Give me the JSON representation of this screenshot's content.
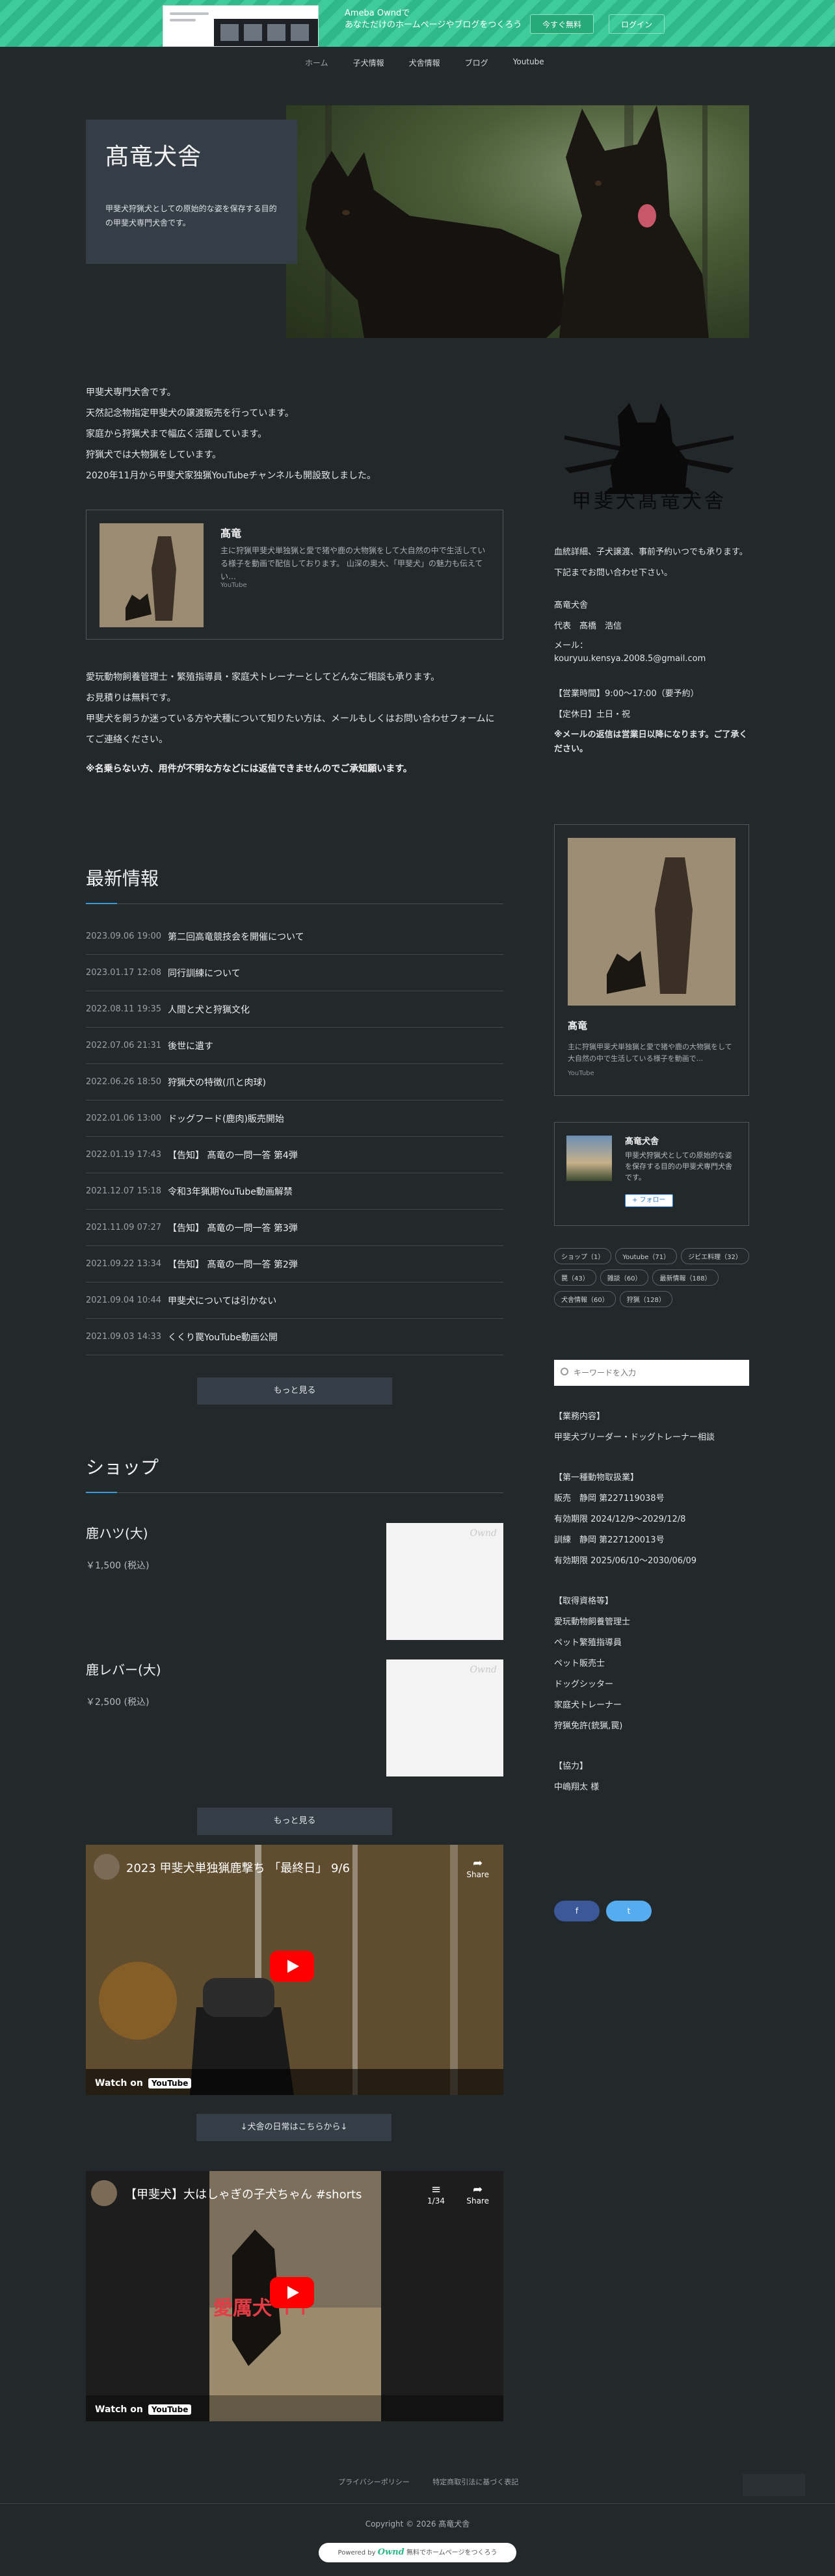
{
  "banner": {
    "copy_line1": "Ameba Owndで",
    "copy_line2": "あなただけのホームページやブログをつくろう",
    "primary_btn": "今すぐ無料",
    "secondary_btn": "ログイン"
  },
  "nav": {
    "items": [
      "ホーム",
      "子犬情報",
      "犬舎情報",
      "ブログ",
      "Youtube"
    ],
    "active": 0
  },
  "hero": {
    "title": "髙竜犬舎",
    "lead": "甲斐犬狩猟犬としての原始的な姿を保存する目的の甲斐犬専門犬舎です。"
  },
  "intro": [
    "甲斐犬専門犬舎です。",
    "天然記念物指定甲斐犬の譲渡販売を行っています。",
    "家庭から狩猟犬まで幅広く活躍しています。",
    "狩猟犬では大物猟をしています。",
    "2020年11月から甲斐犬家独猟YouTubeチャンネルも開設致しました。"
  ],
  "embed": {
    "title": "髙竜",
    "desc": "主に狩猟甲斐犬単独猟と愛で猪や鹿の大物猟をして大自然の中で生活している様子を動画で配信しております。 山深の奥大、「甲斐犬」の魅力も伝えてい…",
    "source": "YouTube"
  },
  "contact_note": [
    "愛玩動物飼養管理士・繁殖指導員・家庭犬トレーナーとしてどんなご相談も承ります。",
    "お見積りは無料です。",
    "甲斐犬を飼うか迷っている方や犬種について知りたい方は、メールもしくはお問い合わせフォームにてご連絡ください。"
  ],
  "caution": "※名乗らない方、用件が不明な方などには返信できませんのでご承知願います。",
  "news": {
    "title": "最新情報",
    "items": [
      {
        "date": "2023.09.06 19:00",
        "text": "第二回高竜競技会を開催について"
      },
      {
        "date": "2023.01.17 12:08",
        "text": "同行訓練について"
      },
      {
        "date": "2022.08.11 19:35",
        "text": "人間と犬と狩猟文化"
      },
      {
        "date": "2022.07.06 21:31",
        "text": "後世に遺す"
      },
      {
        "date": "2022.06.26 18:50",
        "text": "狩猟犬の特徴(爪と肉球)"
      },
      {
        "date": "2022.01.06 13:00",
        "text": "ドッグフード(鹿肉)販売開始"
      },
      {
        "date": "2022.01.19 17:43",
        "text": "【告知】 髙竜の一問一答 第4弾"
      },
      {
        "date": "2021.12.07 15:18",
        "text": "令和3年猟期YouTube動画解禁"
      },
      {
        "date": "2021.11.09 07:27",
        "text": "【告知】 髙竜の一問一答 第3弾"
      },
      {
        "date": "2021.09.22 13:34",
        "text": "【告知】 髙竜の一問一答 第2弾"
      },
      {
        "date": "2021.09.04 10:44",
        "text": "甲斐犬については引かない"
      },
      {
        "date": "2021.09.03 14:33",
        "text": "くくり罠YouTube動画公開"
      }
    ],
    "more": "もっと見る"
  },
  "shop": {
    "title": "ショップ",
    "items": [
      {
        "name": "鹿ハツ(大)",
        "price": "￥1,500 (税込)",
        "badge": "Ownd"
      },
      {
        "name": "鹿レバー(大)",
        "price": "￥2,500 (税込)",
        "badge": "Ownd"
      }
    ],
    "more": "もっと見る"
  },
  "videos": [
    {
      "title": "2023 甲斐犬単独猟鹿撃ち 「最終日」 9/6",
      "share": "Share",
      "watch": "Watch on",
      "yt": "YouTube"
    },
    {
      "title": "【甲斐犬】大はしゃぎの子犬ちゃん #shorts",
      "share": "Share",
      "counter": "1/34",
      "overlay": "愛厲犬 ↑↑",
      "watch": "Watch on",
      "yt": "YouTube"
    }
  ],
  "video_link": "↓犬舎の日常はこちらから↓",
  "side": {
    "logo_text": "甲斐犬髙竜犬舎",
    "visit": "血統詳細、子犬譲渡、事前予約いつでも承ります。",
    "contact": "下記までお問い合わせ下さい。",
    "shop_name": "髙竜犬舎",
    "rep": "代表　髙橋　浩信",
    "mail_label": "メール：",
    "mail": "kouryuu.kensya.2008.5@gmail.com",
    "hours": "【営業時間】9:00〜17:00（要予約）",
    "holiday": "【定休日】土日・祝",
    "mail_note": "※メールの返信は営業日以降になります。ご了承ください。",
    "embed_title": "髙竜",
    "embed_desc": "主に狩猟甲斐犬単独猟と愛で猪や鹿の大物猟をして大自然の中で生活している様子を動画で...",
    "embed_source": "YouTube",
    "profile_name": "髙竜犬舎",
    "profile_desc": "甲斐犬狩猟犬としての原始的な姿を保存する目的の甲斐犬専門犬舎です。",
    "follow": "+ フォロー",
    "tags": [
      "ショップ（1）",
      "Youtube（71）",
      "ジビエ料理（32）",
      "罠（43）",
      "雑談（60）",
      "最新情報（188）",
      "犬舎情報（60）",
      "狩猟（128）"
    ],
    "search_placeholder": "キーワードを入力",
    "business_title": "【業務内容】",
    "business": "甲斐犬ブリーダー・ドッグトレーナー相談",
    "license_title": "【第一種動物取扱業】",
    "license": [
      "販売　静岡 第227119038号",
      "有効期限 2024/12/9〜2029/12/8",
      "訓練　静岡 第227120013号",
      "有効期限 2025/06/10〜2030/06/09"
    ],
    "qual_title": "【取得資格等】",
    "quals": [
      "愛玩動物飼養管理士",
      "ペット繁殖指導員",
      "ペット販売士",
      "ドッグシッター",
      "家庭犬トレーナー",
      "狩猟免許(銃猟,罠)"
    ],
    "coop_title": "【協力】",
    "coop": "中嶋翔太 様",
    "share_fb": "f",
    "share_tw": "t"
  },
  "footer": {
    "privacy": "プライバシーポリシー",
    "law": "特定商取引法に基づく表記",
    "copyright": "Copyright © 2026 髙竜犬舎",
    "powered_prefix": "Powered by",
    "powered_brand": "Ownd",
    "powered_suffix": "無料でホームページをつくろう"
  }
}
